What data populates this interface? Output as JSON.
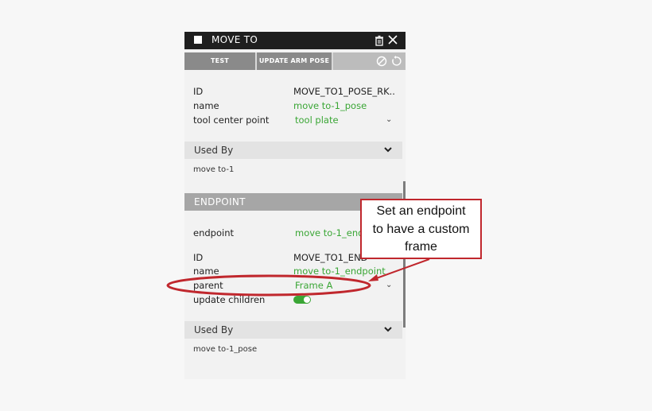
{
  "window": {
    "title": "MOVE TO",
    "icons": [
      "checkbox-icon",
      "trash-icon",
      "close-icon"
    ]
  },
  "toolbar": {
    "test_label": "TEST",
    "update_label": "UPDATE ARM POSE",
    "icons": [
      "disable-icon",
      "reset-icon"
    ]
  },
  "pose": {
    "id_label": "ID",
    "id_value": "MOVE_TO1_POSE_RK..",
    "name_label": "name",
    "name_value": "move to-1_pose",
    "tcp_label": "tool center point",
    "tcp_value": "tool plate"
  },
  "used_by_1": {
    "title": "Used By",
    "item": "move to-1"
  },
  "endpoint_section": {
    "title": "ENDPOINT"
  },
  "endpoint": {
    "endpoint_label": "endpoint",
    "endpoint_value": "move to-1_end",
    "id_label": "ID",
    "id_value": "MOVE_TO1_END",
    "name_label": "name",
    "name_value": "move to-1_endpoint",
    "parent_label": "parent",
    "parent_value": "Frame A",
    "update_children_label": "update children",
    "update_children_on": true
  },
  "used_by_2": {
    "title": "Used By",
    "item": "move to-1_pose"
  },
  "callout": {
    "line1": "Set an endpoint",
    "line2": "to have a custom",
    "line3": "frame"
  },
  "colors": {
    "accent_green": "#3aa635",
    "annotation_red": "#c0272d",
    "titlebar": "#1f1f1f"
  }
}
